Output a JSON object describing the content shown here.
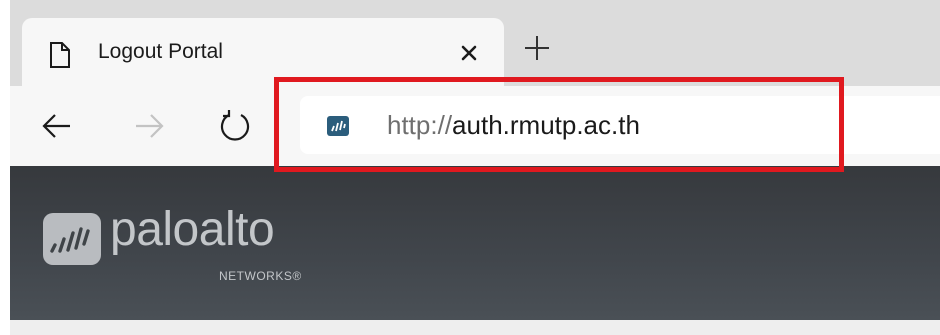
{
  "browser": {
    "tab": {
      "title": "Logout Portal"
    },
    "address_bar": {
      "scheme": "http://",
      "host": "auth.rmutp.ac.th"
    }
  },
  "page": {
    "logo": {
      "name": "paloalto",
      "subtitle": "NETWORKS®"
    }
  },
  "colors": {
    "highlight": "#e0191f",
    "header_bg": "#3d4146",
    "favicon": "#2b5d7c"
  },
  "icons": [
    "page-icon",
    "close-icon",
    "plus-icon",
    "back-arrow-icon",
    "forward-arrow-icon",
    "refresh-icon",
    "site-favicon-icon",
    "paloalto-logo-icon"
  ]
}
